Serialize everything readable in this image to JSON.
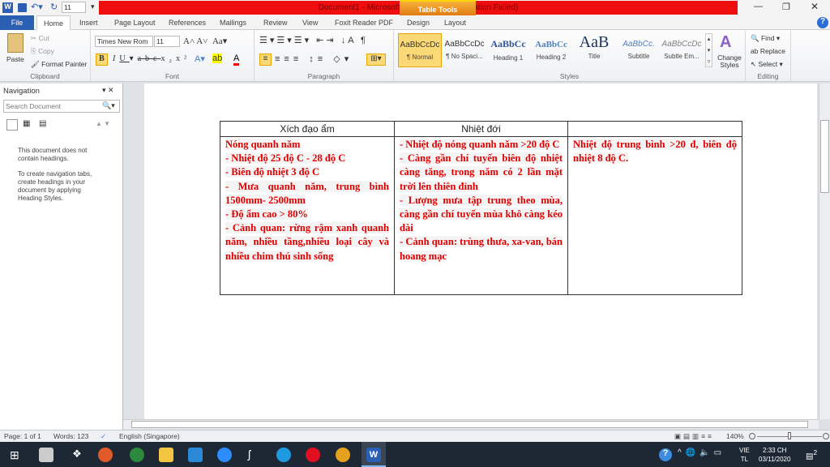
{
  "window": {
    "title": "Document1 - Microsoft Word (Product Activation Failed)",
    "contextual_tab": "Table Tools",
    "qat_font_size": "11"
  },
  "tabs": [
    "File",
    "Home",
    "Insert",
    "Page Layout",
    "References",
    "Mailings",
    "Review",
    "View",
    "Foxit Reader PDF",
    "Design",
    "Layout"
  ],
  "ribbon": {
    "clipboard": {
      "label": "Clipboard",
      "paste": "Paste",
      "cut": "Cut",
      "copy": "Copy",
      "format_painter": "Format Painter"
    },
    "font": {
      "label": "Font",
      "font_name": "Times New Rom",
      "font_size": "11"
    },
    "paragraph": {
      "label": "Paragraph"
    },
    "styles": {
      "label": "Styles",
      "items": [
        {
          "preview": "AaBbCcDc",
          "name": "¶ Normal"
        },
        {
          "preview": "AaBbCcDc",
          "name": "¶ No Spaci..."
        },
        {
          "preview": "AaBbCc",
          "name": "Heading 1"
        },
        {
          "preview": "AaBbCc",
          "name": "Heading 2"
        },
        {
          "preview": "AaB",
          "name": "Title"
        },
        {
          "preview": "AaBbCc.",
          "name": "Subtitle"
        },
        {
          "preview": "AaBbCcDc",
          "name": "Subtle Em..."
        }
      ],
      "change_styles": "Change Styles"
    },
    "editing": {
      "label": "Editing",
      "find": "Find",
      "replace": "Replace",
      "select": "Select"
    }
  },
  "navigation": {
    "title": "Navigation",
    "search_placeholder": "Search Document",
    "msg1": "This document does not contain headings.",
    "msg2": "To create navigation tabs, create headings in your document by applying Heading Styles."
  },
  "table": {
    "headers": [
      "Xích đạo ẩm",
      "Nhiệt đới",
      ""
    ],
    "col1": [
      "Nóng quanh năm",
      "- Nhiệt độ 25 độ C - 28 độ C",
      "- Biên độ nhiệt 3 độ C",
      "- Mưa quanh năm, trung bình 1500mm-  2500mm",
      "- Độ ẩm cao > 80%",
      "- Cảnh quan: rừng rậm xanh quanh năm, nhiều tầng,nhiều loại cây và nhiều chim thú sinh sống"
    ],
    "col2": [
      "- Nhiệt độ nóng quanh năm >20 độ C",
      "- Càng gần chí tuyến biên độ nhiệt càng tăng, trong năm có 2 lần mặt trời lên thiên đỉnh",
      "- Lượng mưa tập trung theo mùa, càng gần chí tuyến mùa khô càng kéo dài",
      "- Cảnh quan: trùng thưa, xa-van, bán hoang mạc"
    ],
    "col3": [
      "Nhiệt độ trung bình >20 đ, biên độ nhiệt 8 độ C."
    ],
    "text_color": "#e00000"
  },
  "status": {
    "page": "Page: 1 of 1",
    "words": "Words: 123",
    "language": "English (Singapore)",
    "zoom": "140%"
  },
  "taskbar": {
    "lang1": "VIE",
    "lang2": "TL",
    "time": "2:33 CH",
    "date": "03/11/2020",
    "notifications": "2"
  }
}
